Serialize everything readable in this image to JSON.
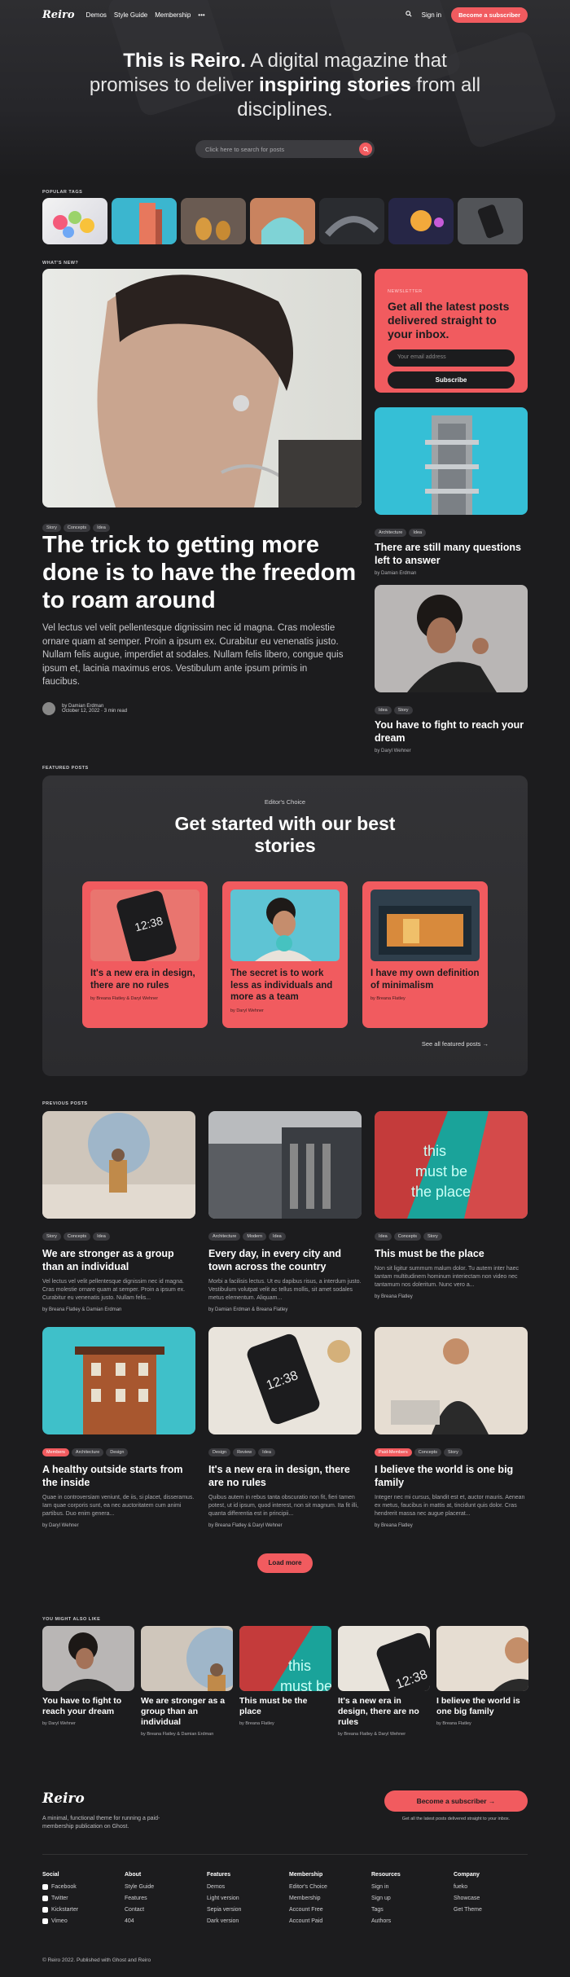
{
  "nav": {
    "logo": "Reiro",
    "links": [
      "Demos",
      "Style Guide",
      "Membership",
      "•••"
    ],
    "signin": "Sign in",
    "subscribe": "Become a subscriber"
  },
  "hero": {
    "title_bold": "This is Reiro.",
    "title_rest1": " A digital magazine that promises to deliver ",
    "title_bold2": "inspiring stories",
    "title_rest2": " from all disciplines.",
    "search_placeholder": "Click here to search for posts"
  },
  "popular_tags_label": "POPULAR TAGS",
  "whats_new_label": "WHAT'S NEW?",
  "featured": {
    "tags": [
      "Story",
      "Concepts",
      "Idea"
    ],
    "title": "The trick to getting more done is to have the freedom to roam around",
    "excerpt": "Vel lectus vel velit pellentesque dignissim nec id magna. Cras molestie ornare quam at semper. Proin a ipsum ex. Curabitur eu venenatis justo. Nullam felis augue, imperdiet at sodales. Nullam felis libero, congue quis ipsum et, lacinia maximus eros. Vestibulum ante ipsum primis in faucibus.",
    "author": "by Damian Erdman",
    "meta": "October 12, 2022 · 3 min read"
  },
  "newsletter": {
    "label": "NEWSLETTER",
    "title": "Get all the latest posts delivered straight to your inbox.",
    "placeholder": "Your email address",
    "button": "Subscribe"
  },
  "side_posts": [
    {
      "tags": [
        "Architecture",
        "Idea"
      ],
      "title": "There are still many questions left to answer",
      "by": "by Damian Erdman"
    },
    {
      "tags": [
        "Idea",
        "Story"
      ],
      "title": "You have to fight to reach your dream",
      "by": "by Daryl Wehner"
    }
  ],
  "featured_posts_label": "FEATURED POSTS",
  "editor": {
    "label": "Editor's Choice",
    "title": "Get started with our best stories",
    "cards": [
      {
        "title": "It's a new era in design, there are no rules",
        "by": "by Breana Flatley & Daryl Wehner"
      },
      {
        "title": "The secret is to work less as individuals and more as a team",
        "by": "by Daryl Wehner"
      },
      {
        "title": "I have my own definition of minimalism",
        "by": "by Breana Flatley"
      }
    ],
    "see_all": "See all featured posts →"
  },
  "previous_label": "PREVIOUS POSTS",
  "previous": [
    {
      "tags": [
        "Story",
        "Concepts",
        "Idea"
      ],
      "title": "We are stronger as a group than an individual",
      "excerpt": "Vel lectus vel velit pellentesque dignissim nec id magna. Cras molestie ornare quam at semper. Proin a ipsum ex. Curabitur eu venenatis justo. Nullam felis...",
      "by": "by Breana Flatley & Damian Erdman"
    },
    {
      "tags": [
        "Architecture",
        "Modern",
        "Idea"
      ],
      "title": "Every day, in every city and town across the country",
      "excerpt": "Morbi a facilisis lectus. Ut eu dapibus risus, a interdum justo. Vestibulum volutpat velit ac tellus mollis, sit amet sodales metus elementum. Aliquam...",
      "by": "by Damian Erdman & Breana Flatley"
    },
    {
      "tags": [
        "Idea",
        "Concepts",
        "Story"
      ],
      "title": "This must be the place",
      "excerpt": "Non sit ligitur summum malum dolor. Tu autem inter haec tantam multitudinem hominum interiectam non video nec tantamum nos doleritum. Nunc vero a...",
      "by": "by Breana Flatley"
    },
    {
      "tags": [
        "Members",
        "Architecture",
        "Design"
      ],
      "title": "A healthy outside starts from the inside",
      "excerpt": "Quae in controversiam veniunt, de iis, si placet, disseramus. Iam quae corporis sunt, ea nec auctoritatem cum animi partibus. Duo enim genera...",
      "by": "by Daryl Wehner"
    },
    {
      "tags": [
        "Design",
        "Review",
        "Idea"
      ],
      "title": "It's a new era in design, there are no rules",
      "excerpt": "Quibus autem in rebus tanta obscuratio non fit, fieri tamen potest, ut id ipsum, quod interest, non sit magnum. Ita fit illi, quanta differentia est in principii...",
      "by": "by Breana Flatley & Daryl Wehner"
    },
    {
      "tags": [
        "Paid-Members",
        "Concepts",
        "Story"
      ],
      "title": "I believe the world is one big family",
      "excerpt": "Integer nec mi cursus, blandit est et, auctor mauris. Aenean ex metus, faucibus in mattis at, tincidunt quis dolor. Cras hendrerit massa nec augue placerat...",
      "by": "by Breana Flatley"
    }
  ],
  "load_more": "Load more",
  "also_like_label": "YOU MIGHT ALSO LIKE",
  "also_like": [
    {
      "title": "You have to fight to reach your dream",
      "by": "by Daryl Wehner"
    },
    {
      "title": "We are stronger as a group than an individual",
      "by": "by Breana Flatley & Damian Erdman"
    },
    {
      "title": "This must be the place",
      "by": "by Breana Flatley"
    },
    {
      "title": "It's a new era in design, there are no rules",
      "by": "by Breana Flatley & Daryl Wehner"
    },
    {
      "title": "I believe the world is one big family",
      "by": "by Breana Flatley"
    }
  ],
  "footer": {
    "logo": "Reiro",
    "desc": "A minimal, functional theme for running a paid-membership publication on Ghost.",
    "subscribe": "Become a subscriber →",
    "subnote": "Get all the latest posts delivered straight to your inbox.",
    "cols": [
      {
        "title": "Social",
        "items": [
          "Facebook",
          "Twitter",
          "Kickstarter",
          "Vimeo"
        ]
      },
      {
        "title": "About",
        "items": [
          "Style Guide",
          "Features",
          "Contact",
          "404"
        ]
      },
      {
        "title": "Features",
        "items": [
          "Demos",
          "Light version",
          "Sepia version",
          "Dark version"
        ]
      },
      {
        "title": "Membership",
        "items": [
          "Editor's Choice",
          "Membership",
          "Account Free",
          "Account Paid"
        ]
      },
      {
        "title": "Resources",
        "items": [
          "Sign in",
          "Sign up",
          "Tags",
          "Authors"
        ]
      },
      {
        "title": "Company",
        "items": [
          "fueko",
          "Showcase",
          "Get Theme"
        ]
      }
    ],
    "copyright": "© Reiro 2022. Published with Ghost and Reiro"
  },
  "colors": {
    "accent": "#f15b5f",
    "bg": "#1c1c1e"
  }
}
